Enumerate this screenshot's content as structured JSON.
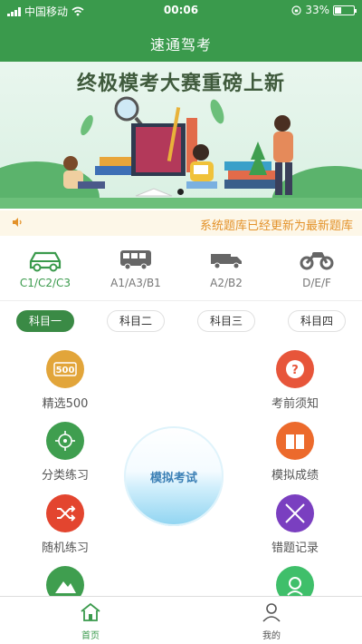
{
  "status": {
    "carrier": "中国移动",
    "time": "00:06",
    "battery": "33%"
  },
  "header": {
    "title": "速通驾考"
  },
  "banner": {
    "headline": "终极模考大赛重磅上新"
  },
  "notice": {
    "text": "系统题库已经更新为最新题库",
    "icon": "speaker-icon"
  },
  "categories": [
    {
      "label": "C1/C2/C3",
      "icon": "car-icon",
      "active": true
    },
    {
      "label": "A1/A3/B1",
      "icon": "bus-icon",
      "active": false
    },
    {
      "label": "A2/B2",
      "icon": "truck-icon",
      "active": false
    },
    {
      "label": "D/E/F",
      "icon": "motorcycle-icon",
      "active": false
    }
  ],
  "subjects": [
    "科目一",
    "科目二",
    "科目三",
    "科目四"
  ],
  "subject_active": "科目一",
  "features": {
    "select500": {
      "label": "精选500",
      "badge": "500",
      "color": "#e2a53a"
    },
    "exam_notes": {
      "label": "考前须知",
      "color": "#e7553a"
    },
    "category_practice": {
      "label": "分类练习",
      "color": "#3f9e4f"
    },
    "mock_results": {
      "label": "模拟成绩",
      "color": "#ec6a2c"
    },
    "random_practice": {
      "label": "随机练习",
      "color": "#e3452f"
    },
    "wrong_records": {
      "label": "错题记录",
      "color": "#7a3fc0"
    },
    "bottom_left_color": "#3f9e4f",
    "bottom_right_color": "#3fbf6a"
  },
  "mock_exam": {
    "label": "模拟考试"
  },
  "tabbar": {
    "home": "首页",
    "mine": "我的"
  },
  "colors": {
    "primary": "#3a9a4c",
    "notice_text": "#e3922a"
  }
}
